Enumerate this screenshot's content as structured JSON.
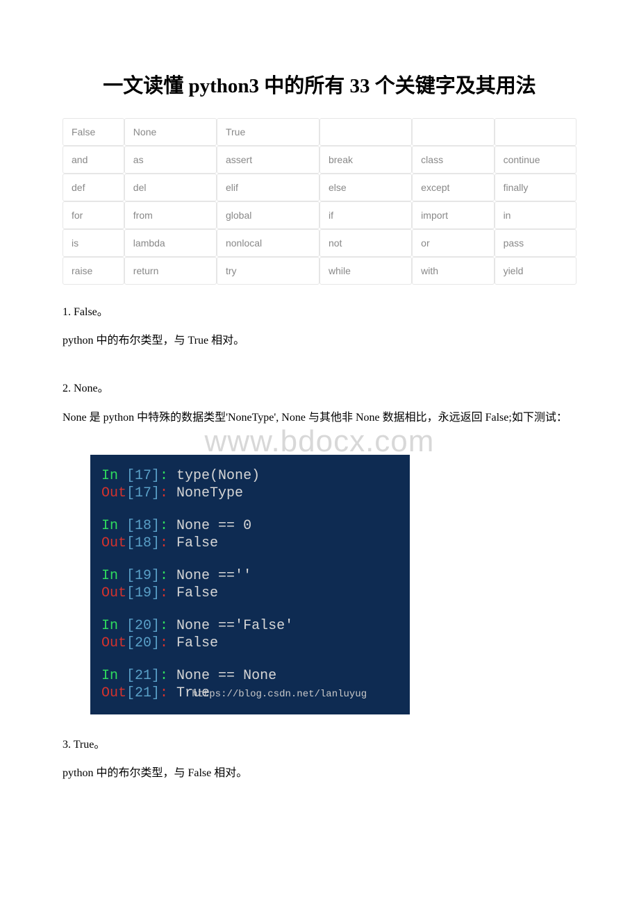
{
  "title": "一文读懂 python3 中的所有 33 个关键字及其用法",
  "keyword_table": [
    [
      "False",
      "None",
      "True",
      "",
      "",
      ""
    ],
    [
      "and",
      "as",
      "assert",
      "break",
      "class",
      "continue"
    ],
    [
      "def",
      "del",
      "elif",
      "else",
      "except",
      "finally"
    ],
    [
      "for",
      "from",
      "global",
      "if",
      "import",
      "in"
    ],
    [
      "is",
      "lambda",
      "nonlocal",
      "not",
      "or",
      "pass"
    ],
    [
      "raise",
      "return",
      "try",
      "while",
      "with",
      "yield"
    ]
  ],
  "sections": {
    "s1_title": "1. False。",
    "s1_body": "python 中的布尔类型，与 True 相对。",
    "s2_title": "2. None。",
    "s2_body": "None 是 python 中特殊的数据类型'NoneType', None 与其他非 None 数据相比，永远返回 False;如下测试：",
    "s3_title": "3. True。",
    "s3_body": "python 中的布尔类型，与 False 相对。"
  },
  "watermark": "www.bdocx.com",
  "terminal": {
    "lines": [
      {
        "in_label": "In ",
        "in_num": "[17]",
        "in_colon": ": ",
        "cmd": "type(None)"
      },
      {
        "out_label": "Out",
        "out_num": "[17]",
        "out_colon": ": ",
        "result": "NoneType"
      },
      {
        "blank": true
      },
      {
        "in_label": "In ",
        "in_num": "[18]",
        "in_colon": ": ",
        "cmd": "None == 0"
      },
      {
        "out_label": "Out",
        "out_num": "[18]",
        "out_colon": ": ",
        "result": "False"
      },
      {
        "blank": true
      },
      {
        "in_label": "In ",
        "in_num": "[19]",
        "in_colon": ": ",
        "cmd": "None ==''"
      },
      {
        "out_label": "Out",
        "out_num": "[19]",
        "out_colon": ": ",
        "result": "False"
      },
      {
        "blank": true
      },
      {
        "in_label": "In ",
        "in_num": "[20]",
        "in_colon": ": ",
        "cmd": "None =='False'"
      },
      {
        "out_label": "Out",
        "out_num": "[20]",
        "out_colon": ": ",
        "result": "False"
      },
      {
        "blank": true
      },
      {
        "in_label": "In ",
        "in_num": "[21]",
        "in_colon": ": ",
        "cmd": "None == None"
      },
      {
        "out_label": "Out",
        "out_num": "[21]",
        "out_colon": ": ",
        "result": "True",
        "url": "https://blog.csdn.net/lanluyug"
      }
    ]
  }
}
